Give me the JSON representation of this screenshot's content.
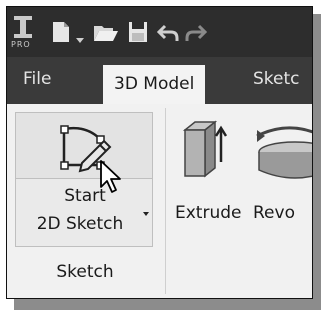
{
  "title_bar": {
    "logo_text": "PRO",
    "icons": [
      "app-logo-icon",
      "new-document-icon",
      "dropdown-arrow-icon",
      "open-folder-icon",
      "save-icon",
      "undo-icon",
      "redo-icon"
    ]
  },
  "tabs": [
    {
      "label": "File",
      "active": false
    },
    {
      "label": "3D Model",
      "active": true
    },
    {
      "label": "Sketc",
      "active": false
    }
  ],
  "ribbon": {
    "start_sketch": {
      "line1": "Start",
      "line2": "2D Sketch"
    },
    "panel_label": "Sketch",
    "extrude_label": "Extrude",
    "revolve_label": "Revo"
  },
  "colors": {
    "titlebar_bg": "#2d2d2d",
    "tabs_bg": "#3a3a3a",
    "ribbon_bg": "#f1f1f1"
  }
}
